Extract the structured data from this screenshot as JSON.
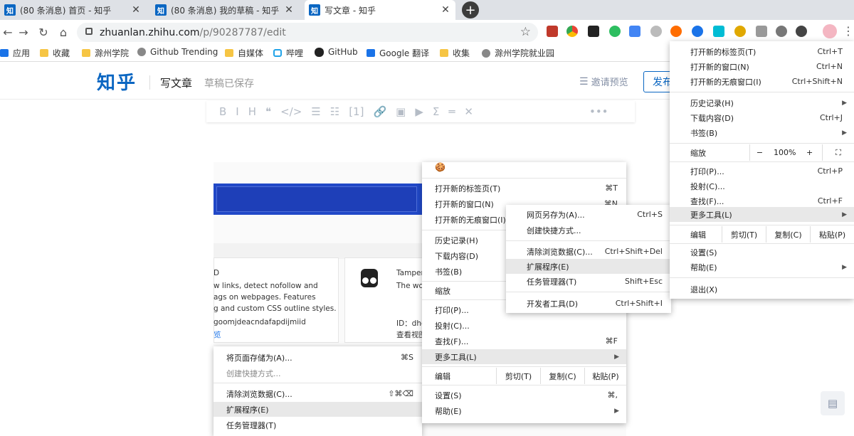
{
  "tabs": [
    {
      "favicon": "知",
      "title": "(80 条消息) 首页 - 知乎"
    },
    {
      "favicon": "知",
      "title": "(80 条消息) 我的草稿 - 知乎"
    },
    {
      "favicon": "知",
      "title": "写文章 - 知乎"
    }
  ],
  "new_tab": "+",
  "url": {
    "host": "zhuanlan.zhihu.com",
    "path": "/p/90287787/edit"
  },
  "bookmarks": [
    "应用",
    "收藏",
    "滁州学院",
    "Github Trending",
    "自媒体",
    "哔哩",
    "GitHub",
    "Google 翻译",
    "收集",
    "滁州学院就业园"
  ],
  "zhihu": {
    "logo": "知乎",
    "page_title": "写文章",
    "status": "草稿已保存",
    "invite": "邀请预览",
    "publish": "发布"
  },
  "editor_toolbar": [
    "B",
    "I",
    "H",
    "❝",
    "</>",
    "☰",
    "☷",
    "[1]",
    "🔗",
    "▣",
    "▶",
    "Σ",
    "═",
    "✕",
    "•••"
  ],
  "screenshot": {
    "card1": [
      "D",
      "w links, detect nofollow and",
      "ags on webpages. Features",
      "g and custom CSS outline styles.",
      "goomjdeacndafapdijmiid",
      "览"
    ],
    "card2": [
      "Tamper",
      "The wo",
      "ID：dhd",
      "查看视图"
    ]
  },
  "menu_mac": {
    "top_icon": "🍪",
    "items": [
      {
        "label": "打开新的标签页(T)",
        "shortcut": "⌘T"
      },
      {
        "label": "打开新的窗口(N)",
        "shortcut": "⌘N"
      },
      {
        "label": "打开新的无痕窗口(I)",
        "shortcut": ""
      },
      {
        "label": "历史记录(H)",
        "shortcut": ""
      },
      {
        "label": "下载内容(D)",
        "shortcut": ""
      },
      {
        "label": "书签(B)",
        "shortcut": ""
      },
      {
        "label": "缩放",
        "shortcut": ""
      },
      {
        "label": "打印(P)...",
        "shortcut": ""
      },
      {
        "label": "投射(C)...",
        "shortcut": ""
      },
      {
        "label": "查找(F)...",
        "shortcut": "⌘F"
      },
      {
        "label": "更多工具(L)",
        "shortcut": ""
      },
      {
        "label": "设置(S)",
        "shortcut": "⌘,"
      },
      {
        "label": "帮助(E)",
        "shortcut": ""
      }
    ],
    "edit": {
      "label": "编辑",
      "cut": "剪切(T)",
      "copy": "复制(C)",
      "paste": "粘贴(P)"
    }
  },
  "submenu_mac_small": {
    "items": [
      {
        "label": "网页另存为(A)...",
        "shortcut": "Ctrl+S"
      },
      {
        "label": "创建快捷方式...",
        "shortcut": ""
      },
      {
        "label": "清除浏览数据(C)...",
        "shortcut": "Ctrl+Shift+Del"
      },
      {
        "label": "扩展程序(E)",
        "shortcut": ""
      },
      {
        "label": "任务管理器(T)",
        "shortcut": "Shift+Esc"
      },
      {
        "label": "开发者工具(D)",
        "shortcut": "Ctrl+Shift+I"
      }
    ]
  },
  "submenu_mac_bottom": {
    "items": [
      {
        "label": "将页面存储为(A)...",
        "shortcut": "⌘S"
      },
      {
        "label": "创建快捷方式...",
        "shortcut": ""
      },
      {
        "label": "清除浏览数据(C)...",
        "shortcut": "⇧⌘⌫"
      },
      {
        "label": "扩展程序(E)",
        "shortcut": ""
      },
      {
        "label": "任务管理器(T)",
        "shortcut": ""
      }
    ]
  },
  "menu_win": {
    "items": [
      {
        "label": "打开新的标签页(T)",
        "shortcut": "Ctrl+T"
      },
      {
        "label": "打开新的窗口(N)",
        "shortcut": "Ctrl+N"
      },
      {
        "label": "打开新的无痕窗口(I)",
        "shortcut": "Ctrl+Shift+N"
      },
      {
        "label": "历史记录(H)",
        "shortcut": ""
      },
      {
        "label": "下载内容(D)",
        "shortcut": "Ctrl+J"
      },
      {
        "label": "书签(B)",
        "shortcut": ""
      },
      {
        "label": "打印(P)...",
        "shortcut": "Ctrl+P"
      },
      {
        "label": "投射(C)...",
        "shortcut": ""
      },
      {
        "label": "查找(F)...",
        "shortcut": "Ctrl+F"
      },
      {
        "label": "更多工具(L)",
        "shortcut": ""
      },
      {
        "label": "设置(S)",
        "shortcut": ""
      },
      {
        "label": "帮助(E)",
        "shortcut": ""
      },
      {
        "label": "退出(X)",
        "shortcut": ""
      }
    ],
    "zoom": {
      "label": "缩放",
      "minus": "−",
      "value": "100%",
      "plus": "+",
      "full": "⛶"
    },
    "edit": {
      "label": "编辑",
      "cut": "剪切(T)",
      "copy": "复制(C)",
      "paste": "粘贴(P)"
    }
  },
  "floating_icon": "feedback-icon"
}
